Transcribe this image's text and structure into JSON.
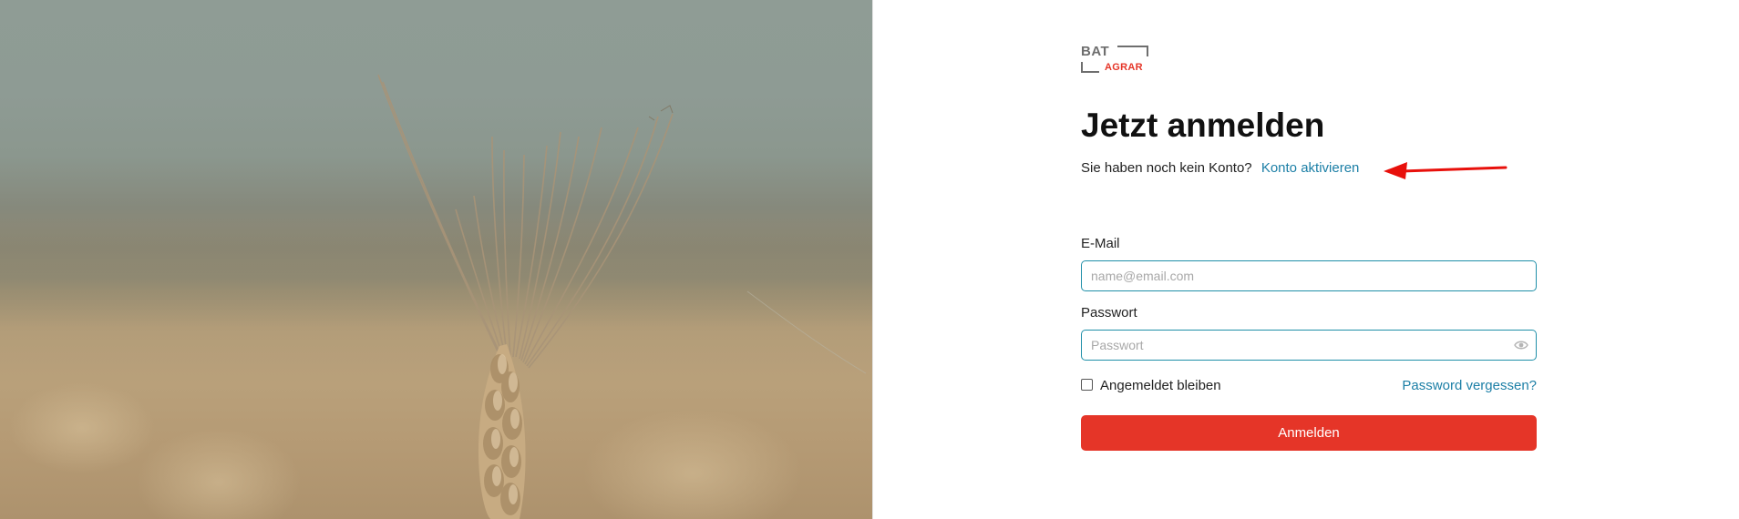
{
  "brand": {
    "logo_top": "BAT",
    "logo_bottom": "AGRAR",
    "accent_color": "#e53528",
    "link_color": "#1c7fa6"
  },
  "hero": {
    "icon": "wheat-ear-photo"
  },
  "login": {
    "title": "Jetzt anmelden",
    "no_account_text": "Sie haben noch kein Konto?",
    "activate_link": "Konto aktivieren",
    "email_label": "E-Mail",
    "email_placeholder": "name@email.com",
    "email_value": "",
    "password_label": "Passwort",
    "password_placeholder": "Passwort",
    "password_value": "",
    "remember_label": "Angemeldet bleiben",
    "remember_checked": false,
    "forgot_link": "Password vergessen?",
    "submit_label": "Anmelden"
  },
  "annotation": {
    "arrow_color": "#e8100b"
  }
}
